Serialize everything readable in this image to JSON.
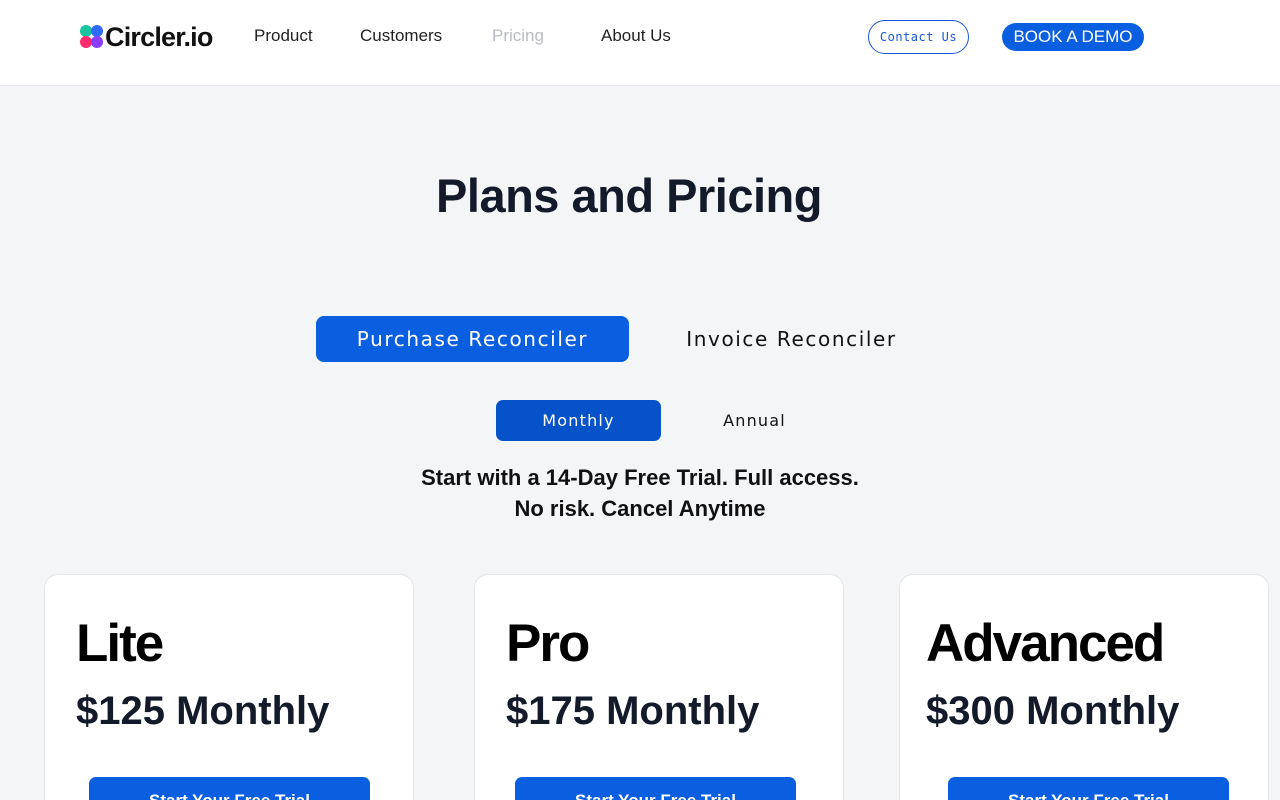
{
  "header": {
    "logo_text": "Circler.io",
    "nav": [
      {
        "label": "Product"
      },
      {
        "label": "Customers"
      },
      {
        "label": "Pricing"
      },
      {
        "label": "About Us"
      }
    ],
    "contact_label": "Contact Us",
    "demo_label": "BOOK A DEMO"
  },
  "main": {
    "title": "Plans and Pricing",
    "product_tabs": [
      {
        "label": "Purchase Reconciler"
      },
      {
        "label": "Invoice Reconciler"
      }
    ],
    "billing_tabs": [
      {
        "label": "Monthly"
      },
      {
        "label": "Annual"
      }
    ],
    "trial_line1": "Start with a 14-Day Free Trial. Full access.",
    "trial_line2": "No risk. Cancel Anytime"
  },
  "plans": [
    {
      "name": "Lite",
      "price": "$125 Monthly",
      "cta": "Start Your Free Trial"
    },
    {
      "name": "Pro",
      "price": "$175 Monthly",
      "cta": "Start Your Free Trial"
    },
    {
      "name": "Advanced",
      "price": "$300 Monthly",
      "cta": "Start Your Free Trial"
    }
  ],
  "colors": {
    "accent": "#0a5ee0",
    "accent_dark": "#0653c9",
    "background": "#f4f5f7"
  }
}
